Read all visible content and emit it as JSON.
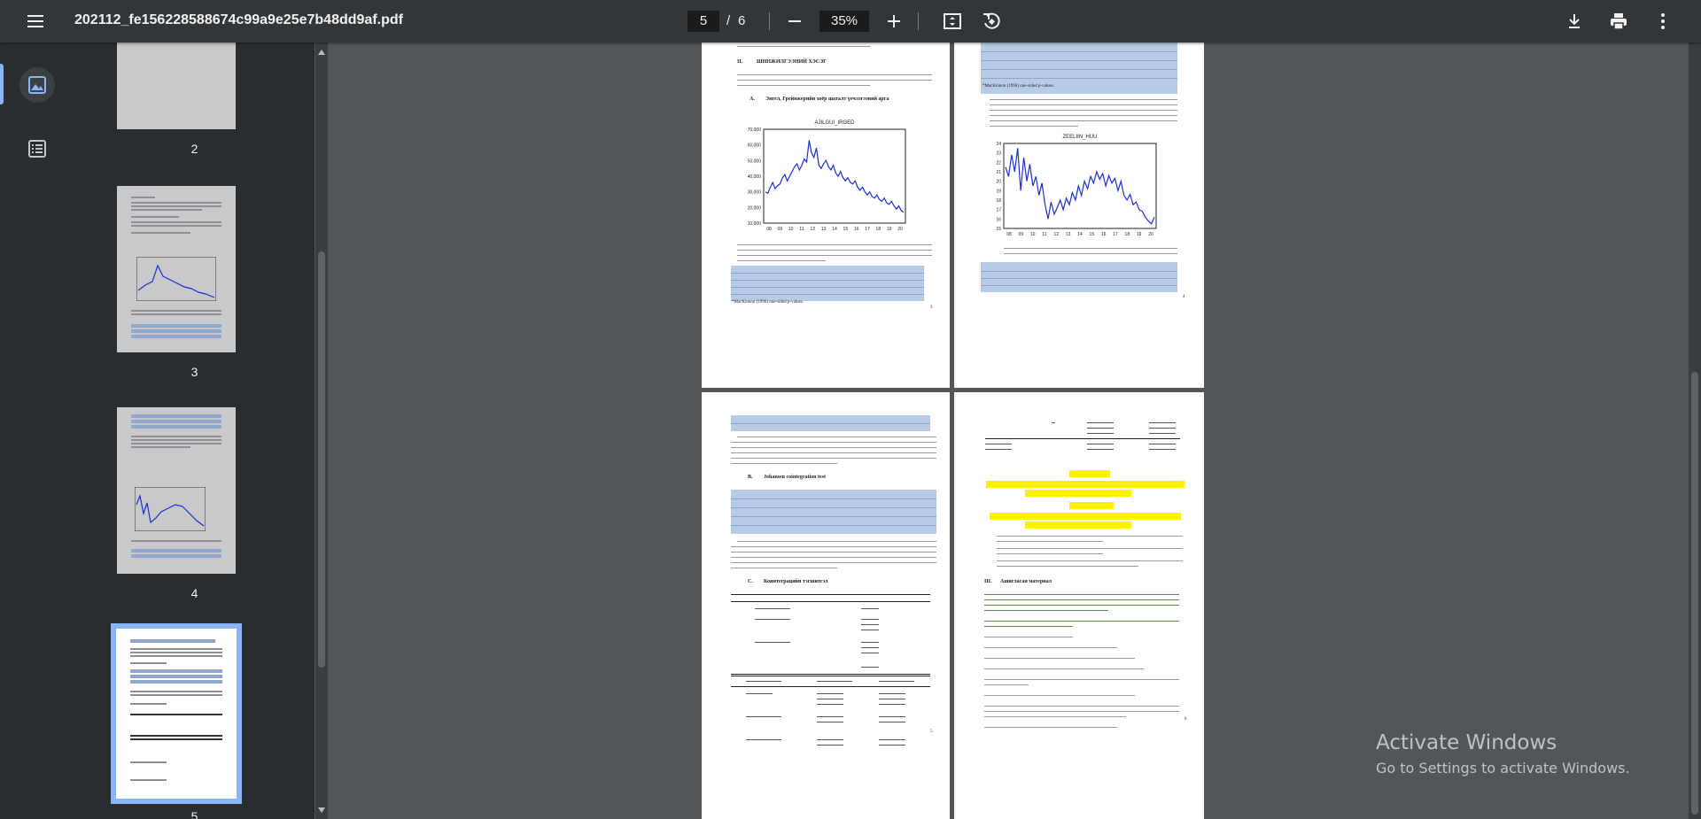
{
  "toolbar": {
    "file_name": "202112_fe156228588674c99a9e25e7b48dd9af.pdf",
    "current_page": "5",
    "page_separator": "/",
    "total_pages": "6",
    "zoom": "35%",
    "icons": [
      "menu-icon",
      "zoom-out-icon",
      "zoom-in-icon",
      "fit-page-icon",
      "rotate-icon",
      "download-icon",
      "print-icon",
      "more-vert-icon"
    ]
  },
  "sidebar": {
    "icons": [
      "thumbnails-icon",
      "outline-icon"
    ],
    "thumbnails": [
      {
        "label": "2"
      },
      {
        "label": "3"
      },
      {
        "label": "4"
      },
      {
        "label": "5"
      }
    ]
  },
  "pages": {
    "p3": {
      "section_num": "II.",
      "section_title": "ШИНЖИЛГЭЭНИЙ ХЭСЭГ",
      "sub_num": "A.",
      "sub_title": "Энгел, Грейнжерийн хоёр шаталт үечлэгээний арга",
      "chart_title": "AJILGUI_IRGED",
      "page_number": "3",
      "table_note": "*MacKinnon (1996) one-sided p-values."
    },
    "p4": {
      "chart_title": "ZEELIIN_HUU",
      "page_number": "4",
      "table_note": "*MacKinnon (1996) one-sided p-values."
    },
    "p5": {
      "sub_b_num": "B.",
      "sub_b_title": "Johansen cointegration test",
      "sub_c_num": "C.",
      "sub_c_title": "Коинтеграцийн тэгшитгэл",
      "page_number": "5"
    },
    "p6": {
      "section_num": "III.",
      "section_title": "Ашигласан материал",
      "page_number": "6"
    }
  },
  "chart_data": [
    {
      "type": "line",
      "title": "AJILGUI_IRGED",
      "xlabel": "",
      "ylabel": "",
      "ylim": [
        10000,
        70000
      ],
      "yticks": [
        "70,000",
        "60,000",
        "50,000",
        "40,000",
        "30,000",
        "20,000",
        "10,000"
      ],
      "xticks": [
        "08",
        "09",
        "10",
        "11",
        "12",
        "13",
        "14",
        "15",
        "16",
        "17",
        "18",
        "19",
        "20"
      ],
      "series": [
        {
          "values": [
            30000,
            29000,
            33000,
            36000,
            32000,
            34000,
            35000,
            39000,
            41000,
            37000,
            40000,
            43000,
            46000,
            48000,
            44000,
            47000,
            51000,
            49000,
            63000,
            55000,
            52000,
            58000,
            47000,
            45000,
            48000,
            50000,
            46000,
            44000,
            47000,
            42000,
            40000,
            43000,
            39000,
            37000,
            39000,
            36000,
            35000,
            37000,
            33000,
            31000,
            33000,
            30000,
            28000,
            30000,
            27000,
            26000,
            28000,
            25000,
            24000,
            26000,
            23000,
            22000,
            24000,
            21000,
            19000,
            21000,
            18000,
            17000
          ]
        }
      ]
    },
    {
      "type": "line",
      "title": "ZEELIIN_HUU",
      "xlabel": "",
      "ylabel": "",
      "ylim": [
        15,
        24
      ],
      "yticks": [
        "24",
        "23",
        "22",
        "21",
        "20",
        "19",
        "18",
        "17",
        "16",
        "15"
      ],
      "xticks": [
        "08",
        "09",
        "10",
        "11",
        "12",
        "13",
        "14",
        "15",
        "16",
        "17",
        "18",
        "19",
        "20"
      ],
      "series": [
        {
          "values": [
            21.5,
            20.5,
            22.8,
            21.0,
            23.5,
            19.0,
            22.5,
            20.0,
            21.8,
            19.5,
            20.5,
            18.5,
            19.8,
            17.5,
            16.0,
            17.8,
            16.5,
            17.2,
            18.0,
            17.0,
            18.2,
            17.5,
            18.8,
            18.0,
            19.5,
            18.5,
            20.0,
            19.2,
            20.5,
            19.8,
            21.0,
            20.2,
            20.8,
            19.5,
            20.6,
            19.8,
            20.3,
            19.0,
            20.0,
            18.5,
            18.0,
            18.6,
            17.5,
            17.8,
            17.0,
            16.8,
            16.2,
            15.8,
            15.5,
            16.2
          ]
        }
      ]
    }
  ],
  "watermark": {
    "line1": "Activate Windows",
    "line2": "Go to Settings to activate Windows."
  }
}
